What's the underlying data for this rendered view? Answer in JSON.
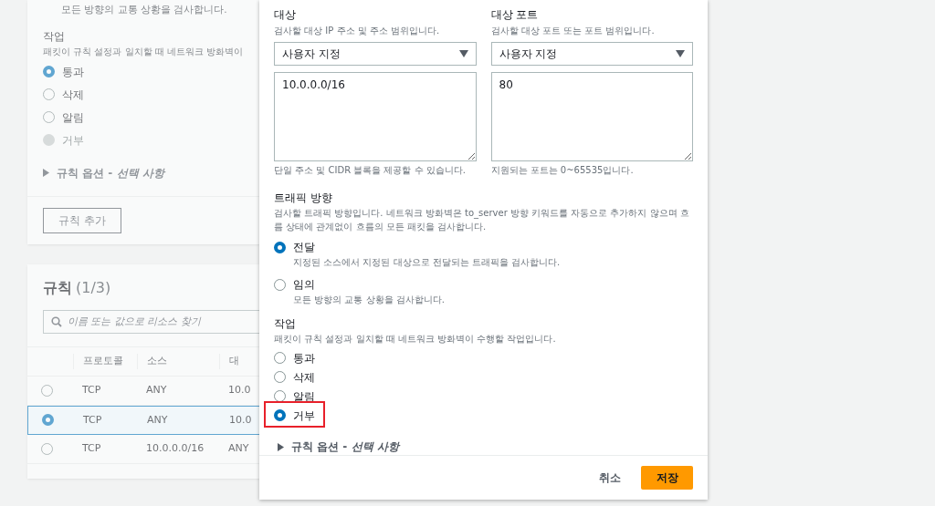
{
  "background": {
    "direction_description": "모든 방향의 교통 상황을 검사합니다.",
    "action": {
      "label": "작업",
      "description": "패킷이 규칙 설정과 일치할 때 네트워크 방화벽이",
      "options": [
        {
          "label": "통과",
          "selected": true,
          "disabled": false
        },
        {
          "label": "삭제",
          "selected": false,
          "disabled": false
        },
        {
          "label": "알림",
          "selected": false,
          "disabled": false
        },
        {
          "label": "거부",
          "selected": false,
          "disabled": true
        }
      ]
    },
    "rule_options": "규칙 옵션 - *선택 사항*",
    "add_rule_button": "규칙 추가"
  },
  "rules_panel": {
    "title": "규칙",
    "count": "(1/3)",
    "search": {
      "placeholder": "이름 또는 값으로 리소스 찾기"
    },
    "columns": [
      "프로토콜",
      "소스",
      "대"
    ],
    "rows": [
      {
        "selected": false,
        "cells": [
          "TCP",
          "ANY",
          "10.0"
        ]
      },
      {
        "selected": true,
        "cells": [
          "TCP",
          "ANY",
          "10.0"
        ]
      },
      {
        "selected": false,
        "cells": [
          "TCP",
          "10.0.0.0/16",
          "ANY"
        ]
      }
    ]
  },
  "dialog": {
    "fields": [
      {
        "label": "대상",
        "description": "검사할 대상 IP 주소 및 주소 범위입니다.",
        "select": "사용자 지정",
        "value": "10.0.0.0/16",
        "hint": "단일 주소 및 CIDR 블록을 제공할 수 있습니다."
      },
      {
        "label": "대상 포트",
        "description": "검사할 대상 포트 또는 포트 범위입니다.",
        "select": "사용자 지정",
        "value": "80",
        "hint": "지원되는 포트는 0~65535입니다."
      }
    ],
    "direction": {
      "label": "트래픽 방향",
      "description": "검사할 트래픽 방향입니다. 네트워크 방화벽은 to_server 방향 키워드를 자동으로 추가하지 않으며 흐름 상태에 관계없이 흐름의 모든 패킷을 검사합니다.",
      "options": [
        {
          "label": "전달",
          "description": "지정된 소스에서 지정된 대상으로 전달되는 트래픽을 검사합니다.",
          "selected": true
        },
        {
          "label": "임의",
          "description": "모든 방향의 교통 상황을 검사합니다.",
          "selected": false
        }
      ]
    },
    "action": {
      "label": "작업",
      "description": "패킷이 규칙 설정과 일치할 때 네트워크 방화벽이 수행할 작업입니다.",
      "options": [
        {
          "label": "통과",
          "selected": false,
          "highlighted": false
        },
        {
          "label": "삭제",
          "selected": false,
          "highlighted": false
        },
        {
          "label": "알림",
          "selected": false,
          "highlighted": false
        },
        {
          "label": "거부",
          "selected": true,
          "highlighted": true
        }
      ]
    },
    "rule_options": "규칙 옵션 - *선택 사항*",
    "cancel_button": "취소",
    "save_button": "저장"
  }
}
